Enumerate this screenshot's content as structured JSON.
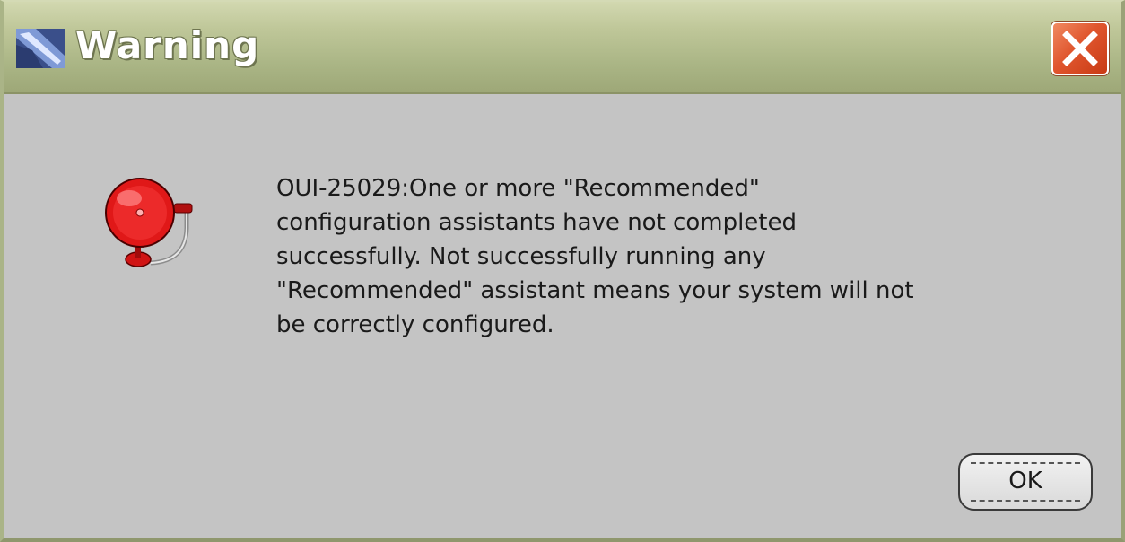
{
  "window": {
    "title": "Warning",
    "title_icon": "oracle-installer-icon",
    "close_icon": "close-icon"
  },
  "dialog": {
    "icon": "alarm-bell-icon",
    "message": "OUI-25029:One or more \"Recommended\"\nconfiguration assistants have not completed\nsuccessfully. Not successfully running any\n\"Recommended\" assistant means your system will not\nbe correctly configured.",
    "ok_label": "OK"
  },
  "colors": {
    "titlebar": "#aab585",
    "close_button": "#e0562e",
    "body": "#c4c4c4",
    "bell": "#e01818"
  }
}
